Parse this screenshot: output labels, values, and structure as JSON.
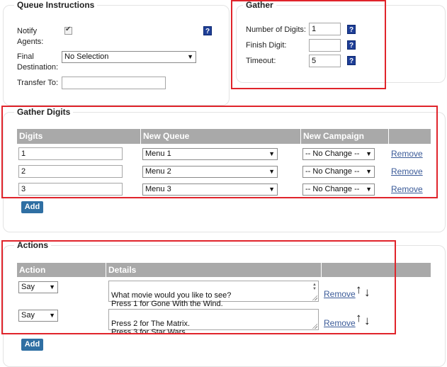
{
  "queue_instructions": {
    "title": "Queue Instructions",
    "notify_label": "Notify\nAgents:",
    "notify_checked": true,
    "final_label": "Final\nDestination:",
    "final_value": "No Selection",
    "transfer_label": "Transfer To:",
    "transfer_value": ""
  },
  "gather": {
    "title": "Gather",
    "digits_label": "Number of Digits:",
    "digits_value": "1",
    "finish_label": "Finish Digit:",
    "finish_value": "",
    "timeout_label": "Timeout:",
    "timeout_value": "5"
  },
  "help_glyph": "?",
  "gather_digits": {
    "title": "Gather Digits",
    "headers": [
      "Digits",
      "New Queue",
      "New Campaign"
    ],
    "rows": [
      {
        "digit": "1",
        "queue": "Menu 1",
        "campaign": "-- No Change --",
        "remove": "Remove"
      },
      {
        "digit": "2",
        "queue": "Menu 2",
        "campaign": "-- No Change --",
        "remove": "Remove"
      },
      {
        "digit": "3",
        "queue": "Menu 3",
        "campaign": "-- No Change --",
        "remove": "Remove"
      }
    ],
    "add_label": "Add"
  },
  "actions": {
    "title": "Actions",
    "headers": [
      "Action",
      "Details"
    ],
    "rows": [
      {
        "action": "Say",
        "details": "What movie would you like to see?\nPress 1 for Gone With the Wind.",
        "remove": "Remove"
      },
      {
        "action": "Say",
        "details": "Press 2 for The Matrix.\nPress 3 for Star Wars.",
        "remove": "Remove"
      }
    ],
    "add_label": "Add",
    "up_glyph": "↑",
    "down_glyph": "↓"
  },
  "colors": {
    "highlight": "#e0242b",
    "header": "#a9a9a9",
    "button": "#2f6fa3",
    "link": "#3a5a98",
    "help": "#1f3f97"
  }
}
